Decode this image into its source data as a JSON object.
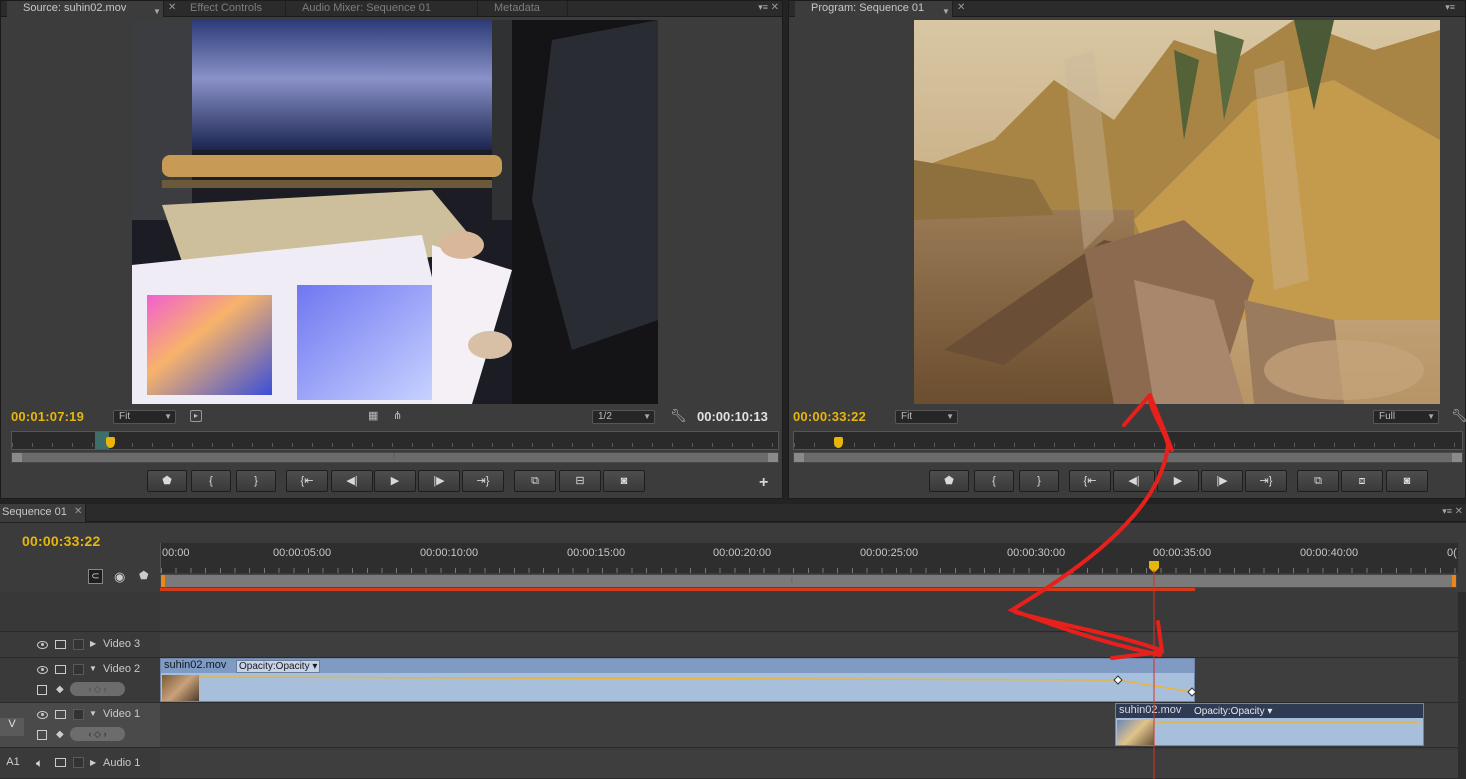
{
  "source_panel": {
    "tabs": [
      "Source: suhin02.mov",
      "Effect Controls",
      "Audio Mixer: Sequence 01",
      "Metadata"
    ],
    "timecode": "00:01:07:19",
    "fit": "Fit",
    "resolution": "1/2",
    "duration": "00:00:10:13"
  },
  "program_panel": {
    "tab": "Program: Sequence 01",
    "timecode": "00:00:33:22",
    "fit": "Fit",
    "resolution": "Full"
  },
  "transport_buttons": [
    "marker",
    "mark-in",
    "mark-out",
    "go-to-in",
    "step-back",
    "play",
    "step-forward",
    "go-to-out",
    "insert",
    "overwrite",
    "export-frame"
  ],
  "timeline": {
    "tab": "Sequence 01",
    "timecode": "00:00:33:22",
    "ruler_labels": [
      "00:00",
      "00:00:05:00",
      "00:00:10:00",
      "00:00:15:00",
      "00:00:20:00",
      "00:00:25:00",
      "00:00:30:00",
      "00:00:35:00",
      "00:00:40:00",
      "0("
    ],
    "tracks": {
      "video3": "Video 3",
      "video2": "Video 2",
      "video1": "Video 1",
      "audio1": "Audio 1",
      "v_label": "V",
      "a1_label": "A1"
    },
    "clips": {
      "clip_v2": {
        "name": "suhin02.mov",
        "effect": "Opacity:Opacity"
      },
      "clip_v1": {
        "name": "suhin02.mov",
        "effect": "Opacity:Opacity"
      }
    }
  },
  "colors": {
    "timecode": "#e8b60b",
    "clip": "#a8bfdc",
    "annotation": "#e8201c",
    "work_area": "#d23a1a"
  },
  "icons": {
    "plus": "+",
    "play": "▶"
  }
}
